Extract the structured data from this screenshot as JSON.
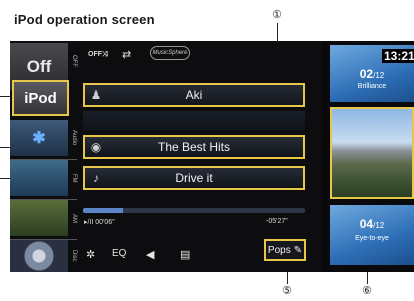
{
  "heading": "iPod operation screen",
  "callouts": {
    "c1": "①",
    "c5": "⑤",
    "c6": "⑥"
  },
  "sources": {
    "off": "Off",
    "ipod": "iPod",
    "labels": {
      "off": "OFF",
      "audio": "Audio",
      "fm": "FM",
      "am": "AM",
      "disc": "Disc"
    }
  },
  "status": {
    "mode": "OFF",
    "musicsphere": "MusicSphere"
  },
  "track": {
    "artist": "Aki",
    "album": "The Best Hits",
    "song": "Drive it",
    "progress": 0.18
  },
  "time": {
    "elapsed": "▸/II 00'06\"",
    "remaining": "-05'27\""
  },
  "controls": {
    "eq": "EQ",
    "genre": "Pops"
  },
  "clock": "13:21",
  "artwork": [
    {
      "number": "02",
      "total": "/12",
      "name": "Brilliance"
    },
    {
      "number": "04",
      "total": "/12",
      "name": "Eye-to-eye"
    }
  ],
  "colors": {
    "highlight": "#e8c64a",
    "screen_bg": "#0d0d0f",
    "progress": "#5a86c8"
  }
}
